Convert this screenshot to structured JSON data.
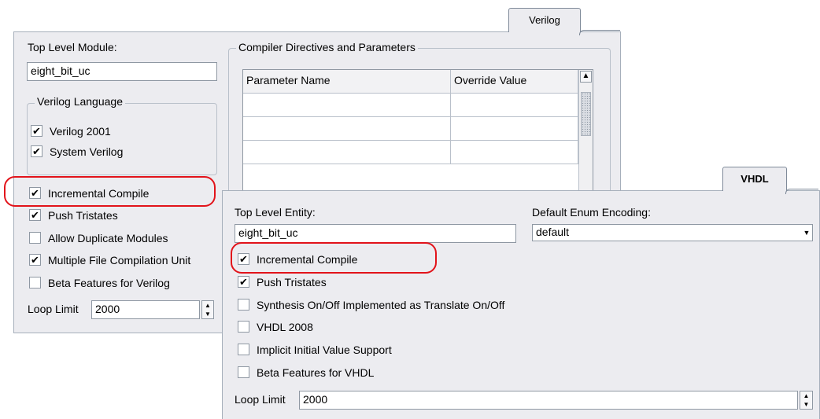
{
  "verilog": {
    "tab_label": "Verilog",
    "top_level_module_label": "Top Level Module:",
    "top_level_module_value": "eight_bit_uc",
    "language_group_title": "Verilog Language",
    "language_options": [
      {
        "label": "Verilog 2001",
        "checked": true
      },
      {
        "label": "System Verilog",
        "checked": true
      }
    ],
    "options": [
      {
        "label": "Incremental Compile",
        "checked": true
      },
      {
        "label": "Push Tristates",
        "checked": true
      },
      {
        "label": "Allow Duplicate Modules",
        "checked": false
      },
      {
        "label": "Multiple File Compilation Unit",
        "checked": true
      },
      {
        "label": "Beta Features for Verilog",
        "checked": false
      }
    ],
    "loop_limit_label": "Loop Limit",
    "loop_limit_value": "2000",
    "directives_group_title": "Compiler Directives and Parameters",
    "param_table": {
      "columns": [
        "Parameter Name",
        "Override Value"
      ],
      "rows": [
        [
          "",
          ""
        ],
        [
          "",
          ""
        ],
        [
          "",
          ""
        ]
      ]
    }
  },
  "vhdl": {
    "tab_label": "VHDL",
    "top_level_entity_label": "Top Level Entity:",
    "top_level_entity_value": "eight_bit_uc",
    "enum_encoding_label": "Default Enum Encoding:",
    "enum_encoding_value": "default",
    "options": [
      {
        "label": "Incremental Compile",
        "checked": true
      },
      {
        "label": "Push Tristates",
        "checked": true
      },
      {
        "label": "Synthesis On/Off Implemented as Translate On/Off",
        "checked": false
      },
      {
        "label": "VHDL 2008",
        "checked": false
      },
      {
        "label": "Implicit Initial Value Support",
        "checked": false
      },
      {
        "label": "Beta Features for VHDL",
        "checked": false
      }
    ],
    "loop_limit_label": "Loop Limit",
    "loop_limit_value": "2000"
  },
  "style": {
    "highlight_color": "#e2131a",
    "panel_color": "#ececf0"
  }
}
